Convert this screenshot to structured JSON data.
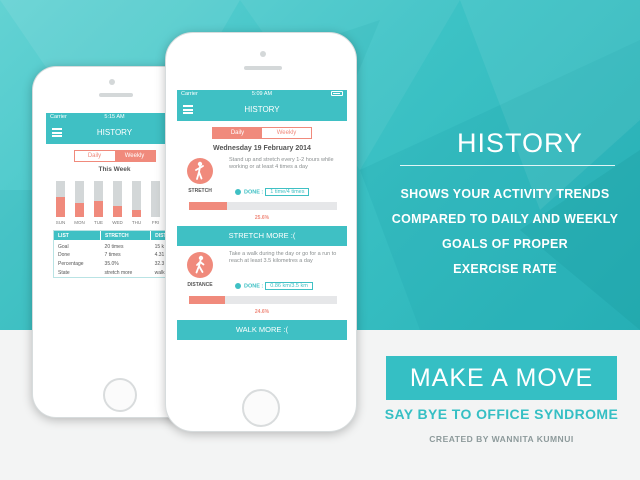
{
  "colors": {
    "accent": "#3fc0c4",
    "coral": "#f08a7c",
    "background_top": "#3ec3c6",
    "background_bottom": "#f3f4f4"
  },
  "headline": "HISTORY",
  "tagline": [
    "SHOWS YOUR ACTIVITY TRENDS",
    "COMPARED TO DAILY AND WEEKLY",
    "GOALS OF PROPER",
    "EXERCISE RATE"
  ],
  "brand": {
    "title": "MAKE A MOVE",
    "subtitle": "SAY BYE TO OFFICE SYNDROME",
    "credit": "CREATED BY WANNITA KUMNUI"
  },
  "back_phone": {
    "status": {
      "carrier": "Carrier",
      "time": "5:15 AM"
    },
    "title": "HISTORY",
    "tabs": [
      {
        "label": "Daily",
        "active": false
      },
      {
        "label": "Weekly",
        "active": true
      }
    ],
    "week_title": "This Week",
    "chart_data": {
      "type": "bar",
      "categories": [
        "SUN",
        "MON",
        "TUE",
        "WED",
        "THU",
        "FRI"
      ],
      "series": [
        {
          "values": [
            1,
            1,
            1,
            1,
            1,
            1
          ]
        },
        {
          "values": [
            0.55,
            0.4,
            0.45,
            0.3,
            0.2,
            0
          ]
        }
      ],
      "ylim": [
        0,
        1
      ]
    },
    "table": {
      "headers": [
        "LIST",
        "STRETCH",
        "DISTA"
      ],
      "rows": [
        [
          "Goal",
          "20 times",
          "15 k"
        ],
        [
          "Done",
          "7 times",
          "4.31"
        ],
        [
          "Percentage",
          "35.0%",
          "32.3"
        ],
        [
          "State",
          "stretch more",
          "walk m"
        ]
      ]
    }
  },
  "front_phone": {
    "status": {
      "carrier": "Carrier",
      "time": "5:09 AM"
    },
    "title": "HISTORY",
    "tabs": [
      {
        "label": "Daily",
        "active": true
      },
      {
        "label": "Weekly",
        "active": false
      }
    ],
    "date": "Wednesday 19 February 2014",
    "activities": [
      {
        "icon": "stretch-icon",
        "name": "STRETCH",
        "description": "Stand up and stretch every 1-2 hours while working or at least 4 times a day",
        "done_label": "DONE :",
        "done_value": "1 time/4 times",
        "progress": 0.256,
        "percent": "25.6%",
        "button": "STRETCH MORE :("
      },
      {
        "icon": "walk-icon",
        "name": "DISTANCE",
        "description": "Take a walk during the day or go for a run to reach at least 3.5 kilometres a day",
        "done_label": "DONE :",
        "done_value": "0.86 km/3.5 km",
        "progress": 0.246,
        "percent": "24.6%",
        "button": "WALK MORE :("
      }
    ]
  }
}
